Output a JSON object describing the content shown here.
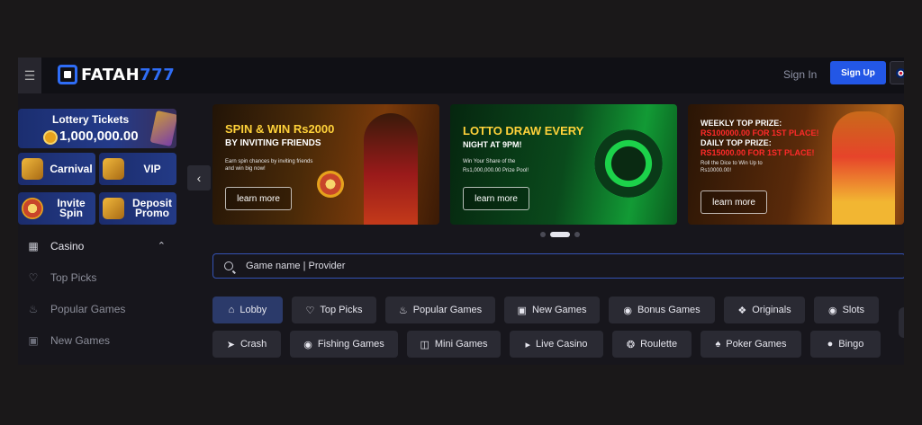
{
  "header": {
    "menu_icon": "hamburger-icon",
    "logo_text": "FATAH",
    "logo_number": "777",
    "signin_label": "Sign In",
    "signup_label": "Sign Up",
    "language_icon": "uk-flag-icon",
    "accent_color": "#2357e6"
  },
  "sidebar": {
    "lottery": {
      "title": "Lottery Tickets",
      "amount": "1,000,000.00"
    },
    "tiles": [
      {
        "label": "Carnival",
        "icon": "treasure-chest-icon"
      },
      {
        "label": "VIP",
        "icon": "vip-crown-icon"
      },
      {
        "label": "Invite Spin",
        "icon": "wheel-icon"
      },
      {
        "label": "Deposit Promo",
        "icon": "money-bag-icon"
      }
    ],
    "nav": {
      "section": {
        "label": "Casino",
        "icon": "casino-icon",
        "state": "expanded"
      },
      "items": [
        {
          "label": "Top Picks",
          "icon": "heart-icon"
        },
        {
          "label": "Popular Games",
          "icon": "flame-icon"
        },
        {
          "label": "New Games",
          "icon": "gift-icon"
        }
      ]
    }
  },
  "banners": [
    {
      "title_line1": "SPIN & WIN Rs2000",
      "title_line2": "BY INVITING FRIENDS",
      "subtitle": "Earn spin chances by inviting friends and win big now!",
      "button": "learn more"
    },
    {
      "title_line1": "LOTTO DRAW EVERY",
      "title_line2": "NIGHT AT 9PM!",
      "subtitle": "Win Your Share of the",
      "subtitle2": "Rs1,000,000.00 Prize Pool!",
      "button": "learn more"
    },
    {
      "line1": "WEEKLY TOP PRIZE:",
      "line2": "RS100000.00 FOR 1ST PLACE!",
      "line3": "DAILY TOP PRIZE:",
      "line4": "RS15000.00 FOR 1ST PLACE!",
      "subtitle": "Roll the Dice to Win Up to Rs10000.00!",
      "button": "learn more"
    }
  ],
  "carousel": {
    "active_index": 1,
    "count": 3
  },
  "search": {
    "placeholder": "Game name | Provider"
  },
  "categories_row1": [
    {
      "label": "Lobby",
      "icon": "home-icon",
      "active": true
    },
    {
      "label": "Top Picks",
      "icon": "heart-icon"
    },
    {
      "label": "Popular Games",
      "icon": "flame-icon"
    },
    {
      "label": "New Games",
      "icon": "gift-icon"
    },
    {
      "label": "Bonus Games",
      "icon": "bonus-icon"
    },
    {
      "label": "Originals",
      "icon": "originals-icon"
    },
    {
      "label": "Slots",
      "icon": "slots-icon"
    }
  ],
  "categories_row2": [
    {
      "label": "Crash",
      "icon": "rocket-icon"
    },
    {
      "label": "Fishing Games",
      "icon": "fish-icon"
    },
    {
      "label": "Mini Games",
      "icon": "gamepad-icon"
    },
    {
      "label": "Live Casino",
      "icon": "video-icon"
    },
    {
      "label": "Roulette",
      "icon": "roulette-icon"
    },
    {
      "label": "Poker Games",
      "icon": "spade-icon"
    },
    {
      "label": "Bingo",
      "icon": "bingo-icon"
    }
  ]
}
